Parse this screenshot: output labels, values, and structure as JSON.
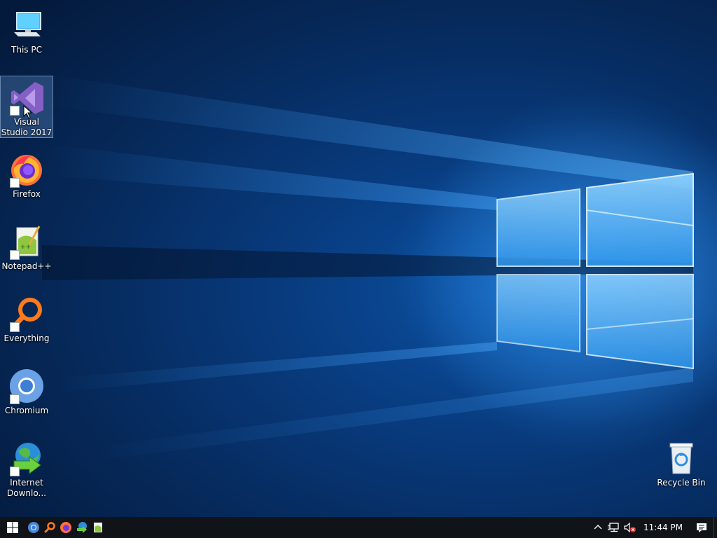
{
  "desktop": {
    "icons": [
      {
        "label": "This PC"
      },
      {
        "label": "Visual Studio 2017"
      },
      {
        "label": "Firefox"
      },
      {
        "label": "Notepad++"
      },
      {
        "label": "Everything"
      },
      {
        "label": "Chromium"
      },
      {
        "label": "Internet Downlo..."
      }
    ],
    "recycle_bin": {
      "label": "Recycle Bin"
    },
    "selected_icon": "Visual Studio 2017"
  },
  "taskbar": {
    "start_icon": "windows-logo-icon",
    "pinned": [
      {
        "name": "chromium-icon"
      },
      {
        "name": "everything-icon"
      },
      {
        "name": "firefox-icon"
      },
      {
        "name": "internet-download-manager-icon"
      },
      {
        "name": "notepadpp-icon"
      }
    ],
    "tray": {
      "icons": [
        "chevron-up-icon",
        "network-icon",
        "volume-muted-icon"
      ],
      "clock": "11:44 PM",
      "notification_icon": "action-center-icon"
    }
  },
  "colors": {
    "taskbar": "#101318",
    "wallpaper_dark": "#041a3c",
    "wallpaper_light": "#3aa0ff"
  }
}
